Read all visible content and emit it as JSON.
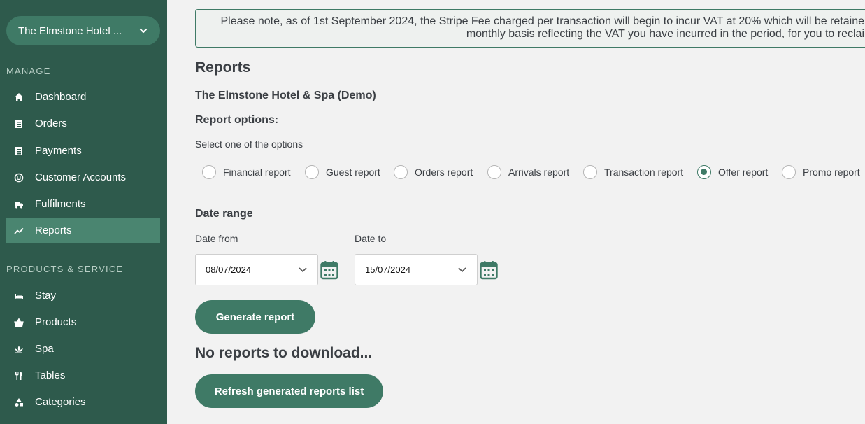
{
  "sidebar": {
    "venue_name": "The Elmstone Hotel ...",
    "manage_label": "MANAGE",
    "manage_items": [
      {
        "label": "Dashboard",
        "icon": "home-icon"
      },
      {
        "label": "Orders",
        "icon": "receipt-icon"
      },
      {
        "label": "Payments",
        "icon": "receipt-icon"
      },
      {
        "label": "Customer Accounts",
        "icon": "smiley-icon"
      },
      {
        "label": "Fulfilments",
        "icon": "truck-icon"
      },
      {
        "label": "Reports",
        "icon": "trend-line-icon",
        "active": true
      }
    ],
    "products_label": "PRODUCTS & SERVICE",
    "product_items": [
      {
        "label": "Stay",
        "icon": "bed-icon"
      },
      {
        "label": "Products",
        "icon": "basket-icon"
      },
      {
        "label": "Spa",
        "icon": "lotus-icon"
      },
      {
        "label": "Tables",
        "icon": "cutlery-icon"
      },
      {
        "label": "Categories",
        "icon": "shapes-icon"
      }
    ]
  },
  "notice": {
    "line1": "Please note, as of 1st September 2024, the Stripe Fee charged per transaction will begin to incur VAT at 20% which will be retaine",
    "line2": "monthly basis reflecting the VAT you have incurred in the period, for you to reclai"
  },
  "main": {
    "title": "Reports",
    "venue": "The Elmstone Hotel & Spa (Demo)",
    "options_heading": "Report options:",
    "select_hint": "Select one of the options",
    "report_types": [
      {
        "label": "Financial report",
        "checked": false
      },
      {
        "label": "Guest report",
        "checked": false
      },
      {
        "label": "Orders report",
        "checked": false
      },
      {
        "label": "Arrivals report",
        "checked": false
      },
      {
        "label": "Transaction report",
        "checked": false
      },
      {
        "label": "Offer report",
        "checked": true
      },
      {
        "label": "Promo report",
        "checked": false
      }
    ],
    "date_range_heading": "Date range",
    "date_from_label": "Date from",
    "date_from_value": "08/07/2024",
    "date_to_label": "Date to",
    "date_to_value": "15/07/2024",
    "generate_label": "Generate report",
    "no_reports": "No reports to download...",
    "refresh_label": "Refresh generated reports list"
  },
  "colors": {
    "sidebar_bg": "#2e5a4c",
    "accent": "#3f7a66",
    "active_item": "#4a8570"
  }
}
